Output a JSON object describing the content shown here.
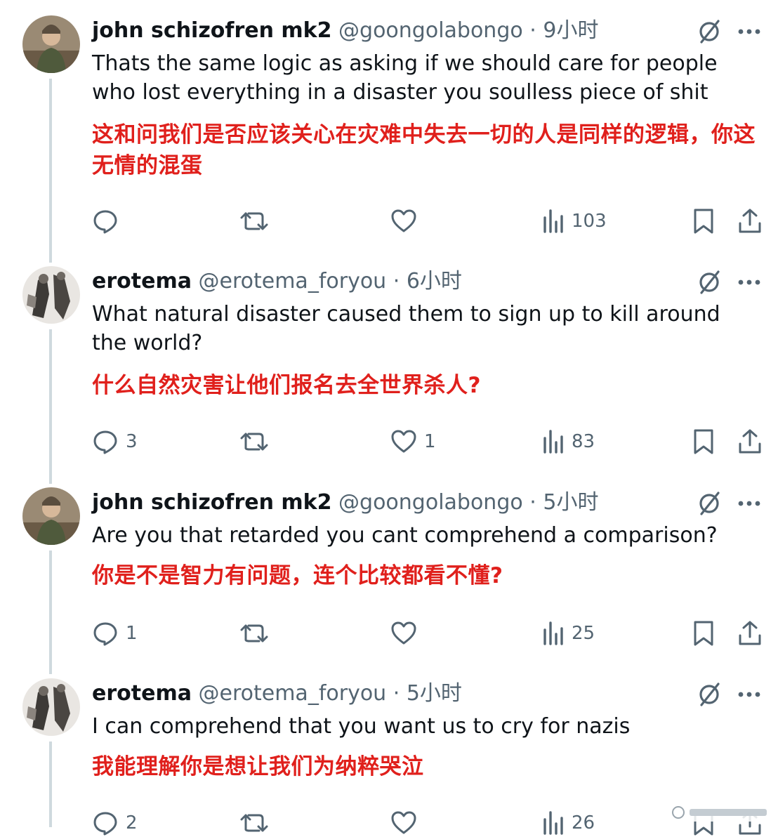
{
  "tweets": [
    {
      "name": "john schizofren mk2",
      "handle": "@goongolabongo",
      "separator": "·",
      "time": "9小时",
      "text": "Thats the same logic as asking if we should care for people who lost everything in a disaster you soulless piece of shit",
      "translation": "这和问我们是否应该关心在灾难中失去一切的人是同样的逻辑，你这无情的混蛋",
      "replies": "",
      "reposts": "",
      "likes": "",
      "views": "103"
    },
    {
      "name": "erotema",
      "handle": "@erotema_foryou",
      "separator": "·",
      "time": "6小时",
      "text": "What natural disaster caused them to sign up to kill around the world?",
      "translation": "什么自然灾害让他们报名去全世界杀人?",
      "replies": "3",
      "reposts": "",
      "likes": "1",
      "views": "83"
    },
    {
      "name": "john schizofren mk2",
      "handle": "@goongolabongo",
      "separator": "·",
      "time": "5小时",
      "text": "Are you that retarded you cant comprehend a comparison?",
      "translation": "你是不是智力有问题，连个比较都看不懂?",
      "replies": "1",
      "reposts": "",
      "likes": "",
      "views": "25"
    },
    {
      "name": "erotema",
      "handle": "@erotema_foryou",
      "separator": "·",
      "time": "5小时",
      "text": "I can comprehend that you want us to cry for nazis",
      "translation": "我能理解你是想让我们为纳粹哭泣",
      "replies": "2",
      "reposts": "",
      "likes": "",
      "views": "26"
    }
  ],
  "icons": {
    "reply": "reply-icon",
    "repost": "repost-icon",
    "like": "like-icon",
    "views": "views-icon",
    "bookmark": "bookmark-icon",
    "share": "share-icon",
    "more": "more-icon",
    "verified": "grok-slash-icon"
  },
  "colors": {
    "text": "#0f1419",
    "secondary": "#536471",
    "translation": "#e0201c",
    "thread_line": "#cfd9de"
  }
}
